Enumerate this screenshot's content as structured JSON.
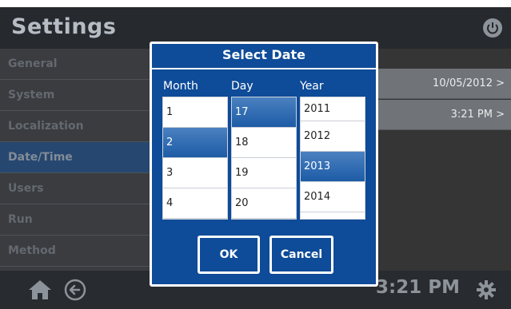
{
  "header": {
    "title": "Settings",
    "power_icon": "power-icon"
  },
  "sidebar": {
    "items": [
      {
        "label": "General"
      },
      {
        "label": "System"
      },
      {
        "label": "Localization"
      },
      {
        "label": "Date/Time",
        "active": true
      },
      {
        "label": "Users"
      },
      {
        "label": "Run"
      },
      {
        "label": "Method"
      }
    ]
  },
  "right_panel": {
    "date_value": "10/05/2012 >",
    "time_value": "3:21 PM >"
  },
  "footer": {
    "time": "3:21 PM",
    "home_icon": "home-icon",
    "back_icon": "back-arrow-icon",
    "settings_icon": "gear-icon"
  },
  "dialog": {
    "title": "Select Date",
    "columns": {
      "month": "Month",
      "day": "Day",
      "year": "Year"
    },
    "months": [
      "1",
      "2",
      "3",
      "4"
    ],
    "days": [
      "17",
      "18",
      "19",
      "20"
    ],
    "years": [
      "2011",
      "2012",
      "2013",
      "2014"
    ],
    "selected": {
      "month": "2",
      "day": "17",
      "year": "2013"
    },
    "ok_label": "OK",
    "cancel_label": "Cancel"
  },
  "colors": {
    "accent": "#0e4b98",
    "selected": "#1d5ca6"
  }
}
